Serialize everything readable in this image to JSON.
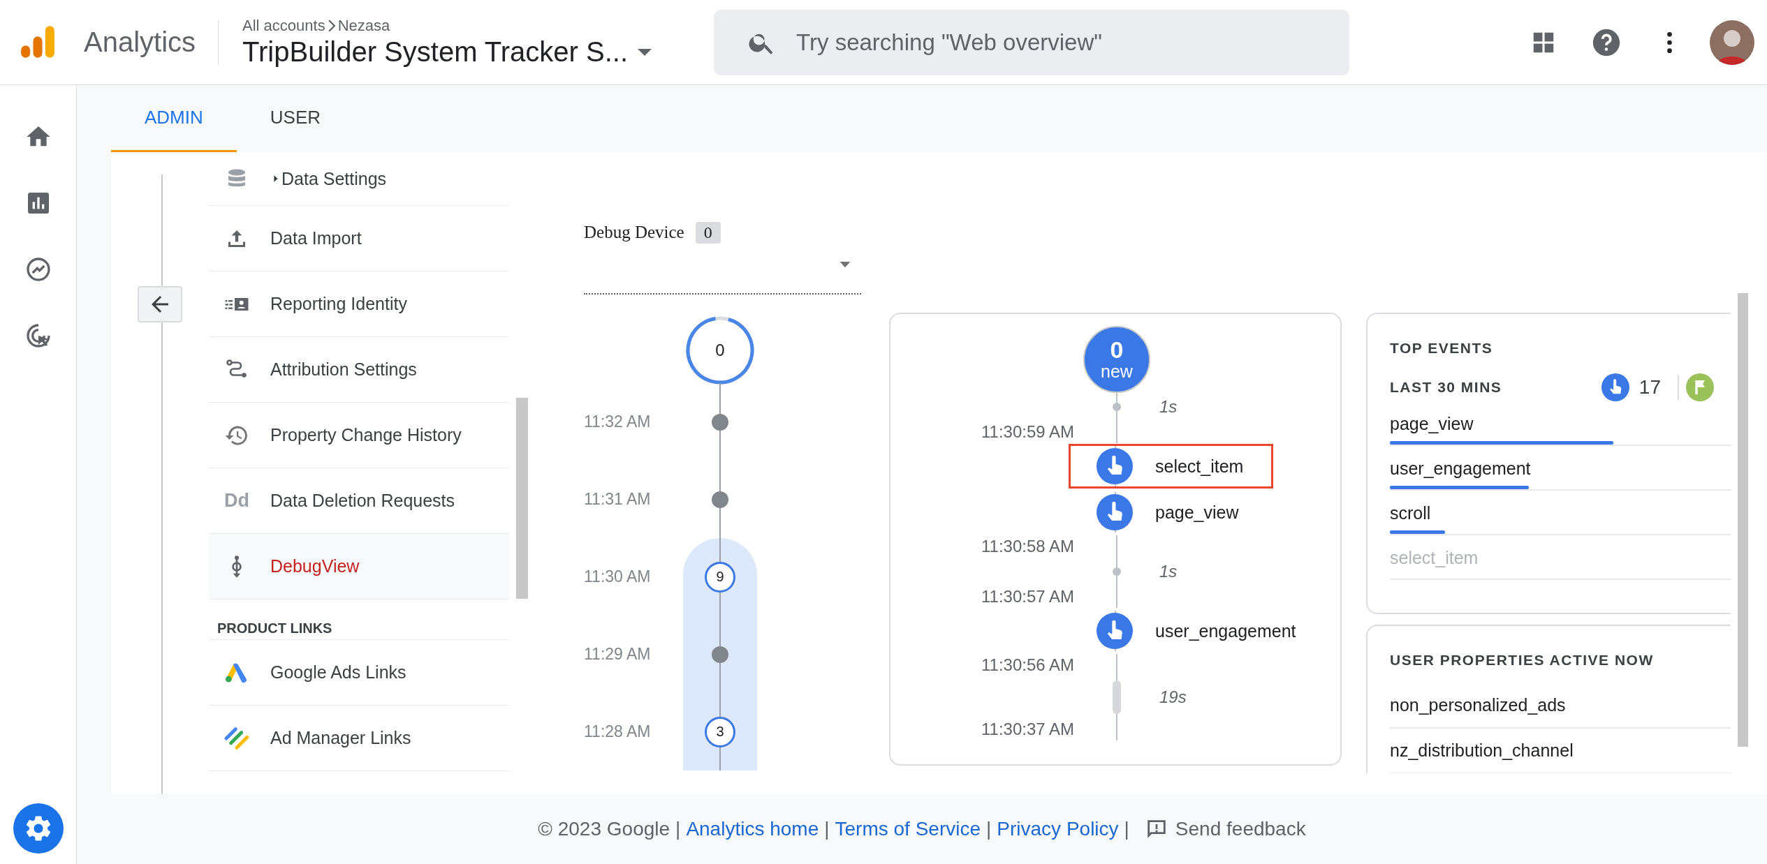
{
  "header": {
    "product": "Analytics",
    "breadcrumb": [
      "All accounts",
      "Nezasa"
    ],
    "property": "TripBuilder System Tracker S...",
    "search": {
      "placeholder": "Try searching \"Web overview\""
    }
  },
  "rail": [
    {
      "kind": "home"
    },
    {
      "kind": "reports"
    },
    {
      "kind": "explore"
    },
    {
      "kind": "advertising"
    }
  ],
  "tabs": [
    {
      "label": "ADMIN",
      "selected": true
    },
    {
      "label": "USER",
      "selected": false
    }
  ],
  "nav": [
    {
      "kind": "item",
      "label": "Data Settings",
      "selected": false
    },
    {
      "kind": "item",
      "label": "Data Import",
      "selected": false
    },
    {
      "kind": "item",
      "label": "Reporting Identity",
      "selected": false
    },
    {
      "kind": "item",
      "label": "Attribution Settings",
      "selected": false
    },
    {
      "kind": "item",
      "label": "Property Change History",
      "selected": false
    },
    {
      "kind": "item",
      "icon_text": "Dd",
      "label": "Data Deletion Requests",
      "selected": false
    },
    {
      "kind": "item",
      "label": "DebugView",
      "selected": true
    },
    {
      "kind": "section",
      "label": "PRODUCT LINKS"
    },
    {
      "kind": "item",
      "label": "Google Ads Links",
      "selected": false
    },
    {
      "kind": "item",
      "label": "Ad Manager Links",
      "selected": false
    }
  ],
  "debug_device": {
    "label": "Debug Device",
    "count": "0"
  },
  "minutes": {
    "current": "0",
    "rows": [
      {
        "time": "11:32 AM",
        "kind": "dot",
        "selected": false
      },
      {
        "time": "11:31 AM",
        "kind": "dot",
        "selected": false
      },
      {
        "time": "11:30 AM",
        "kind": "count",
        "count": "9",
        "selected": true
      },
      {
        "time": "11:29 AM",
        "kind": "dot",
        "selected": true
      },
      {
        "time": "11:28 AM",
        "kind": "count",
        "count": "3",
        "selected": true
      }
    ]
  },
  "seconds": {
    "current": "0",
    "current_label": "new",
    "rows": [
      {
        "kind": "gap",
        "duration": "1s"
      },
      {
        "kind": "time",
        "time": "11:30:59 AM"
      },
      {
        "kind": "event",
        "name": "select_item",
        "selected": true
      },
      {
        "kind": "event",
        "name": "page_view",
        "selected": false
      },
      {
        "kind": "time",
        "time": "11:30:58 AM"
      },
      {
        "kind": "gap",
        "duration": "1s"
      },
      {
        "kind": "time",
        "time": "11:30:57 AM"
      },
      {
        "kind": "event",
        "name": "user_engagement",
        "selected": false
      },
      {
        "kind": "time",
        "time": "11:30:56 AM"
      },
      {
        "kind": "pause",
        "duration": "19s"
      },
      {
        "kind": "time",
        "time": "11:30:37 AM"
      }
    ]
  },
  "top_events": {
    "title": "TOP EVENTS",
    "subtitle": "LAST 30 MINS",
    "event_count": "17",
    "items": [
      {
        "name": "page_view",
        "level": 0.61,
        "dimmed": false
      },
      {
        "name": "user_engagement",
        "level": 0.38,
        "dimmed": false
      },
      {
        "name": "scroll",
        "level": 0.15,
        "dimmed": false
      },
      {
        "name": "select_item",
        "dimmed": true
      }
    ]
  },
  "user_properties": {
    "title": "USER PROPERTIES ACTIVE NOW",
    "items": [
      "non_personalized_ads",
      "nz_distribution_channel"
    ]
  },
  "footer": {
    "items": [
      {
        "kind": "text",
        "text": "© 2023 Google"
      },
      {
        "kind": "sep",
        "text": "|"
      },
      {
        "kind": "link",
        "text": "Analytics home"
      },
      {
        "kind": "sep",
        "text": "|"
      },
      {
        "kind": "link",
        "text": "Terms of Service"
      },
      {
        "kind": "sep",
        "text": "|"
      },
      {
        "kind": "link",
        "text": "Privacy Policy"
      },
      {
        "kind": "sep",
        "text": "|"
      }
    ],
    "feedback": "Send feedback"
  }
}
